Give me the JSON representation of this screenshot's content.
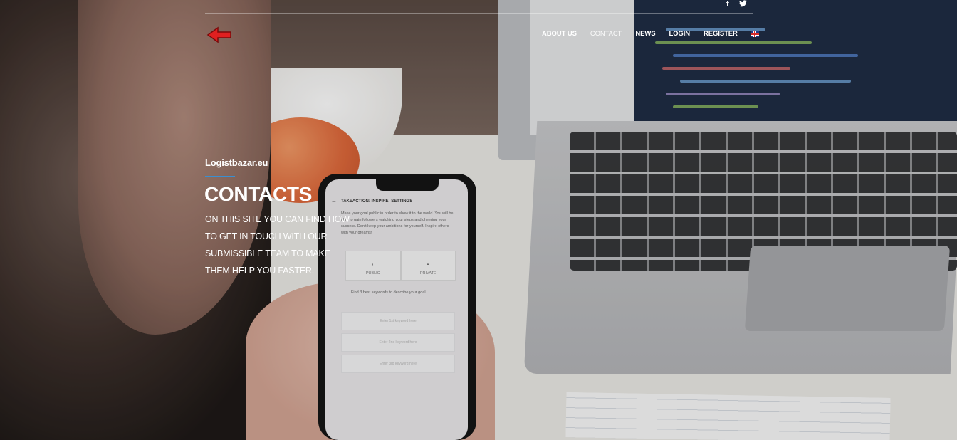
{
  "social": {
    "facebook": "f",
    "twitter": "t"
  },
  "nav": {
    "items": [
      {
        "label": "ABOUT US"
      },
      {
        "label": "CONTACT"
      },
      {
        "label": "NEWS"
      },
      {
        "label": "LOGIN"
      },
      {
        "label": "REGISTER"
      }
    ],
    "language_icon": "uk-flag-icon"
  },
  "hero": {
    "site_name": "Logistbazar.eu",
    "title": "CONTACTS",
    "description": "ON THIS SITE YOU CAN FIND HOW TO GET IN TOUCH WITH OUR SUBMISSIBLE TEAM TO MAKE THEM HELP YOU FASTER."
  },
  "colors": {
    "accent": "#3a8fd1",
    "logo_arrow": "#e02020"
  },
  "phone_screen": {
    "title": "TAKEACTION: INSPIRE! SETTINGS",
    "text": "Make your goal public in order to show it to the world. You will be able to gain followers watching your steps and cheering your success. Don't keep your ambitions for yourself. Inspire others with your dreams!",
    "public_label": "PUBLIC",
    "private_label": "PRIVATE",
    "find_text": "Find 3 best keywords to describe your goal.",
    "input1": "Enter 1st keyword here",
    "input2": "Enter 2nd keyword here",
    "input3": "Enter 3rd keyword here"
  }
}
